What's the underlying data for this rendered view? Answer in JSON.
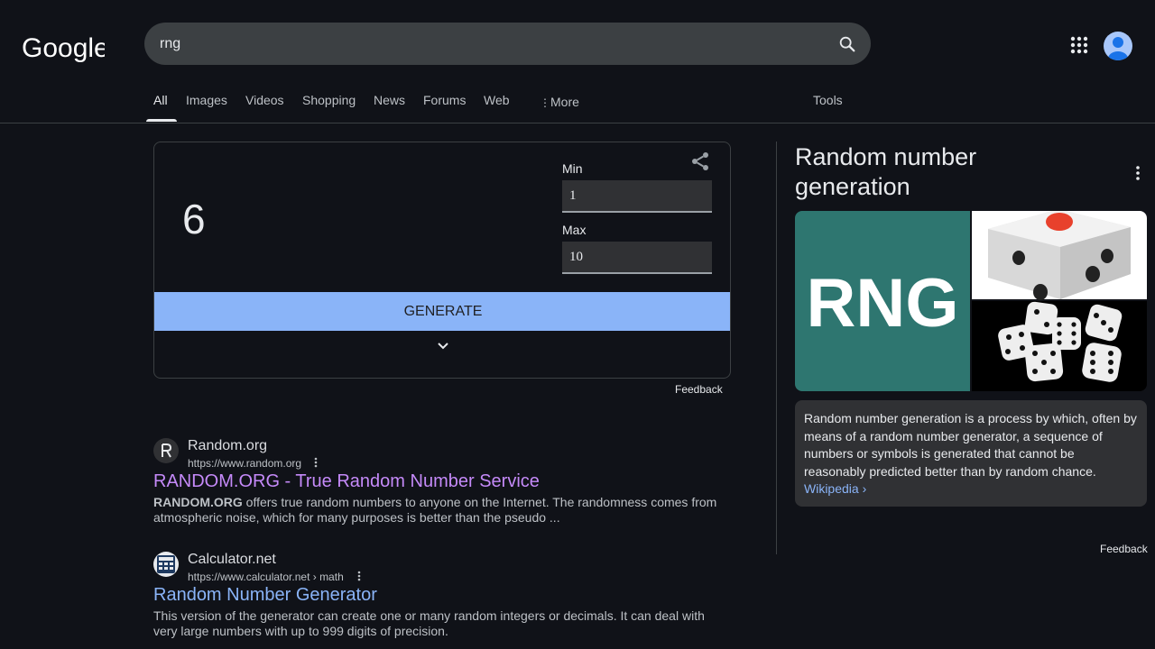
{
  "search": {
    "query": "rng"
  },
  "tabs": [
    "All",
    "Images",
    "Videos",
    "Shopping",
    "News",
    "Forums",
    "Web"
  ],
  "more_label": "More",
  "tools_label": "Tools",
  "rng": {
    "result": "6",
    "min_label": "Min",
    "min_value": "1",
    "max_label": "Max",
    "max_value": "10",
    "generate_label": "GENERATE",
    "feedback": "Feedback"
  },
  "results": [
    {
      "site": "Random.org",
      "url": "https://www.random.org",
      "title": "RANDOM.ORG - True Random Number Service",
      "snippet_bold": "RANDOM.ORG",
      "snippet": " offers true random numbers to anyone on the Internet. The randomness comes from atmospheric noise, which for many purposes is better than the pseudo ..."
    },
    {
      "site": "Calculator.net",
      "url": "https://www.calculator.net › math",
      "title": "Random Number Generator",
      "snippet": "This version of the generator can create one or many random integers or decimals. It can deal with very large numbers with up to 999 digits of precision."
    }
  ],
  "knowledge_panel": {
    "title": "Random number generation",
    "image_text": "RNG",
    "description": "Random number generation is a process by which, often by means of a random number generator, a sequence of numbers or symbols is generated that cannot be reasonably predicted better than by random chance.",
    "source_link": "Wikipedia ›",
    "feedback": "Feedback"
  },
  "colors": {
    "background": "#101218",
    "accent": "#8ab4f8",
    "visited": "#c58af9",
    "rng_image_bg": "#2e7670"
  }
}
